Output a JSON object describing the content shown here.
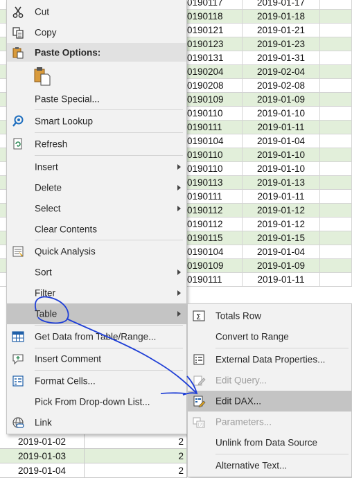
{
  "grid": {
    "rows": [
      {
        "c1": "0190117",
        "c2": "2019-01-17",
        "green": false
      },
      {
        "c1": "0190118",
        "c2": "2019-01-18",
        "green": true
      },
      {
        "c1": "0190121",
        "c2": "2019-01-21",
        "green": false
      },
      {
        "c1": "0190123",
        "c2": "2019-01-23",
        "green": true
      },
      {
        "c1": "0190131",
        "c2": "2019-01-31",
        "green": false
      },
      {
        "c1": "0190204",
        "c2": "2019-02-04",
        "green": true
      },
      {
        "c1": "0190208",
        "c2": "2019-02-08",
        "green": false
      },
      {
        "c1": "0190109",
        "c2": "2019-01-09",
        "green": true
      },
      {
        "c1": "0190110",
        "c2": "2019-01-10",
        "green": false
      },
      {
        "c1": "0190111",
        "c2": "2019-01-11",
        "green": true
      },
      {
        "c1": "0190104",
        "c2": "2019-01-04",
        "green": false
      },
      {
        "c1": "0190110",
        "c2": "2019-01-10",
        "green": true
      },
      {
        "c1": "0190110",
        "c2": "2019-01-10",
        "green": false
      },
      {
        "c1": "0190113",
        "c2": "2019-01-13",
        "green": true
      },
      {
        "c1": "0190111",
        "c2": "2019-01-11",
        "green": false
      },
      {
        "c1": "0190112",
        "c2": "2019-01-12",
        "green": true
      },
      {
        "c1": "0190112",
        "c2": "2019-01-12",
        "green": false
      },
      {
        "c1": "0190115",
        "c2": "2019-01-15",
        "green": true
      },
      {
        "c1": "0190104",
        "c2": "2019-01-04",
        "green": false
      },
      {
        "c1": "0190109",
        "c2": "2019-01-09",
        "green": true
      },
      {
        "c1": "0190111",
        "c2": "2019-01-11",
        "green": false
      }
    ],
    "bottom_rows": [
      {
        "a": "2019-01-02",
        "b": "2",
        "green": false
      },
      {
        "a": "2019-01-03",
        "b": "2",
        "green": true
      },
      {
        "a": "2019-01-04",
        "b": "2",
        "green": false
      }
    ]
  },
  "menu": {
    "cut": "Cut",
    "copy": "Copy",
    "paste_options": "Paste Options:",
    "paste_special": "Paste Special...",
    "smart_lookup": "Smart Lookup",
    "refresh": "Refresh",
    "insert": "Insert",
    "delete": "Delete",
    "select": "Select",
    "clear_contents": "Clear Contents",
    "quick_analysis": "Quick Analysis",
    "sort": "Sort",
    "filter": "Filter",
    "table": "Table",
    "get_data": "Get Data from Table/Range...",
    "insert_comment": "Insert Comment",
    "format_cells": "Format Cells...",
    "pick_list": "Pick From Drop-down List...",
    "link": "Link"
  },
  "submenu": {
    "totals_row": "Totals Row",
    "convert_to_range": "Convert to Range",
    "external_data_properties": "External Data Properties...",
    "edit_query": "Edit Query...",
    "edit_dax": "Edit DAX...",
    "parameters": "Parameters...",
    "unlink": "Unlink from Data Source",
    "alt_text": "Alternative Text..."
  },
  "colors": {
    "annotation": "#1f3fd6",
    "highlight": "#c4c4c4",
    "menu_bg": "#f2f2f2",
    "row_green": "#e2efda"
  }
}
